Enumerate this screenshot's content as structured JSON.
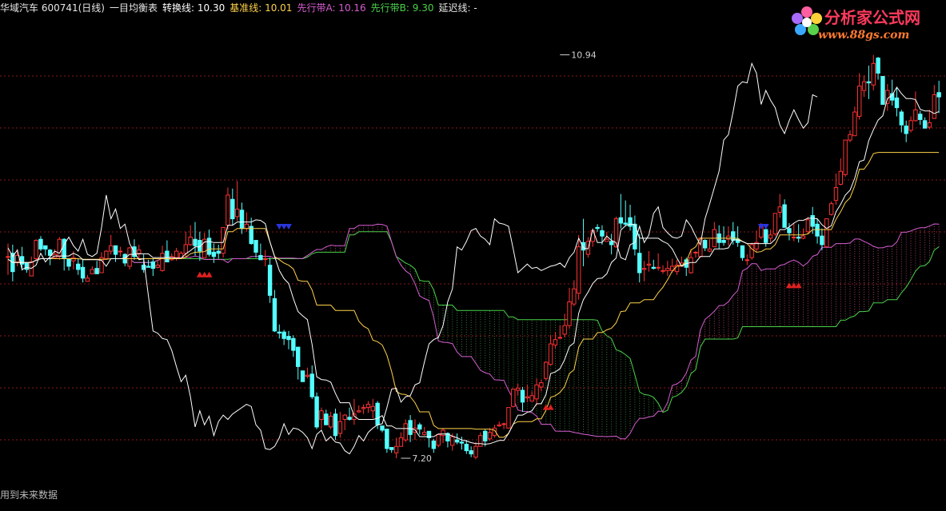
{
  "header": {
    "title": "华域汽车 600741(日线)",
    "indicator": "一目均衡表",
    "zhuanhuan": "转换线: 10.30",
    "jizhun": "基准线: 10.01",
    "xianxingA": "先行带A: 10.16",
    "xianxingB": "先行带B: 9.30",
    "yanchi": "延迟线: -"
  },
  "brand": {
    "name": "分析家公式网",
    "url": "www.88gs.com"
  },
  "footer": {
    "note": "用到未来数据"
  },
  "colors": {
    "background": "#000000",
    "up_candle": "#ff3232",
    "down_candle": "#54ffff",
    "tenkan": "#ffffff",
    "kijun": "#ffd24a",
    "senkou_a": "#d55cd0",
    "senkou_b": "#4ad14a",
    "chikou": "#ffffff",
    "grid": "#8b1a1a"
  },
  "chart_data": {
    "type": "candlestick",
    "ylim": [
      7.0,
      11.3
    ],
    "annotations": [
      {
        "label": "10.94",
        "x": 118,
        "price": 10.94
      },
      {
        "label": "7.20",
        "x": 84,
        "price": 7.2
      }
    ],
    "signal_markers": [
      {
        "shape": "up-triangle",
        "x": [
          41,
          42,
          43
        ],
        "price": 8.9
      },
      {
        "shape": "down-triangle",
        "x": [
          58,
          59,
          60
        ],
        "price": 9.35
      },
      {
        "shape": "up-triangle",
        "x": [
          115,
          116
        ],
        "price": 7.67
      },
      {
        "shape": "down-triangle",
        "x": [
          161,
          162
        ],
        "price": 9.35
      },
      {
        "shape": "up-triangle",
        "x": [
          167,
          168,
          169
        ],
        "price": 8.8
      }
    ],
    "candles": [
      [
        9.07,
        9.19,
        9.07,
        8.9
      ],
      [
        9.1,
        9.18,
        8.93,
        8.84
      ],
      [
        9.02,
        9.14,
        9.08,
        8.98
      ],
      [
        9.07,
        9.16,
        9,
        8.94
      ],
      [
        9.01,
        9.02,
        8.95,
        8.92
      ],
      [
        8.89,
        9.07,
        9.02,
        8.89
      ],
      [
        9.05,
        9.23,
        9.22,
        9.03
      ],
      [
        9.23,
        9.26,
        9.14,
        9.12
      ],
      [
        9.17,
        9.17,
        9.14,
        9.08
      ],
      [
        9.13,
        9.14,
        9.08,
        8.99
      ],
      [
        9.06,
        9.14,
        9.09,
        9.05
      ],
      [
        9.07,
        9.25,
        9.23,
        9.04
      ],
      [
        9.23,
        9.24,
        9.05,
        8.94
      ],
      [
        9.05,
        9.05,
        8.98,
        8.94
      ],
      [
        9.03,
        9.12,
        9.06,
        8.95
      ],
      [
        9,
        9.05,
        8.95,
        8.9
      ],
      [
        8.97,
        9.05,
        8.87,
        8.83
      ],
      [
        8.84,
        8.9,
        8.87,
        8.84
      ],
      [
        8.91,
        8.98,
        8.95,
        8.91
      ],
      [
        8.96,
        9.03,
        8.91,
        8.91
      ],
      [
        8.92,
        9.11,
        9.06,
        8.92
      ],
      [
        9.05,
        9.13,
        9.12,
        9.05
      ],
      [
        9.12,
        9.27,
        9.17,
        9.09
      ],
      [
        9.17,
        9.17,
        9.09,
        9.02
      ],
      [
        9.12,
        9.16,
        9.12,
        9.07
      ],
      [
        9.09,
        9.1,
        9.01,
        8.98
      ],
      [
        8.98,
        9.16,
        9.15,
        8.95
      ],
      [
        9.16,
        9.23,
        9.07,
        9.04
      ],
      [
        9.1,
        9.18,
        9.13,
        9.05
      ],
      [
        8.99,
        9.09,
        8.95,
        8.92
      ],
      [
        8.98,
        9.04,
        8.97,
        8.97
      ],
      [
        9.02,
        9.05,
        8.96,
        8.89
      ],
      [
        8.97,
        9.04,
        8.99,
        8.96
      ],
      [
        8.94,
        9.17,
        9.1,
        8.93
      ],
      [
        9.12,
        9.22,
        9.02,
        9.02
      ],
      [
        9.04,
        9.1,
        9.07,
        9.03
      ],
      [
        9.06,
        9.15,
        9.12,
        9.03
      ],
      [
        9.05,
        9.12,
        9.1,
        9.05
      ],
      [
        9.1,
        9.3,
        9.18,
        9.07
      ],
      [
        9.18,
        9.36,
        9.25,
        9.17
      ],
      [
        9.23,
        9.39,
        9.17,
        9.08
      ],
      [
        9.22,
        9.3,
        9.12,
        9.03
      ],
      [
        9.06,
        9.29,
        9.23,
        9.06
      ],
      [
        9.24,
        9.32,
        9.09,
        9.07
      ],
      [
        9.11,
        9.19,
        9.07,
        9.01
      ],
      [
        9.12,
        9.18,
        9.1,
        9.05
      ],
      [
        9.1,
        9.34,
        9.34,
        9.06
      ],
      [
        9.36,
        9.71,
        9.64,
        9.32
      ],
      [
        9.6,
        9.7,
        9.42,
        9.36
      ],
      [
        9.44,
        9.77,
        9.51,
        9.4
      ],
      [
        9.5,
        9.57,
        9.33,
        9.28
      ],
      [
        9.33,
        9.48,
        9.37,
        9.3
      ],
      [
        9.35,
        9.43,
        9.19,
        9.18
      ],
      [
        9.22,
        9.22,
        9.11,
        9.06
      ],
      [
        9.08,
        9.19,
        9.04,
        9.04
      ],
      [
        9.05,
        9.13,
        9.05,
        8.98
      ],
      [
        8.99,
        9.06,
        8.71,
        8.64
      ],
      [
        8.68,
        8.76,
        8.38,
        8.37
      ],
      [
        8.37,
        8.44,
        8.36,
        8.31
      ],
      [
        8.37,
        8.39,
        8.31,
        8.25
      ],
      [
        8.33,
        8.38,
        8.3,
        8.21
      ],
      [
        8.31,
        8.34,
        8.2,
        8.14
      ],
      [
        8.23,
        8.23,
        8.05,
        7.93
      ],
      [
        8.01,
        8.01,
        7.91,
        7.91
      ],
      [
        7.96,
        8.04,
        7.97,
        7.94
      ],
      [
        7.98,
        8.06,
        7.77,
        7.75
      ],
      [
        7.77,
        7.81,
        7.49,
        7.47
      ],
      [
        7.56,
        7.67,
        7.64,
        7.47
      ],
      [
        7.61,
        7.65,
        7.51,
        7.51
      ],
      [
        7.49,
        7.63,
        7.59,
        7.47
      ],
      [
        7.61,
        7.66,
        7.41,
        7.37
      ],
      [
        7.43,
        7.63,
        7.54,
        7.39
      ],
      [
        7.56,
        7.61,
        7.6,
        7.46
      ],
      [
        7.58,
        7.67,
        7.56,
        7.55
      ],
      [
        7.56,
        7.75,
        7.61,
        7.51
      ],
      [
        7.63,
        7.69,
        7.64,
        7.62
      ],
      [
        7.66,
        7.7,
        7.67,
        7.61
      ],
      [
        7.67,
        7.73,
        7.7,
        7.62
      ],
      [
        7.64,
        7.75,
        7.68,
        7.57
      ],
      [
        7.71,
        7.73,
        7.51,
        7.47
      ],
      [
        7.5,
        7.5,
        7.46,
        7.44
      ],
      [
        7.47,
        7.47,
        7.29,
        7.25
      ],
      [
        7.3,
        7.3,
        7.28,
        7.25
      ],
      [
        7.25,
        7.39,
        7.31,
        7.2
      ],
      [
        7.31,
        7.44,
        7.39,
        7.31
      ],
      [
        7.37,
        7.56,
        7.52,
        7.35
      ],
      [
        7.55,
        7.6,
        7.42,
        7.35
      ],
      [
        7.44,
        7.56,
        7.48,
        7.37
      ],
      [
        7.51,
        7.53,
        7.47,
        7.42
      ],
      [
        7.42,
        7.49,
        7.44,
        7.41
      ],
      [
        7.45,
        7.45,
        7.39,
        7.3
      ],
      [
        7.36,
        7.38,
        7.29,
        7.25
      ],
      [
        7.32,
        7.43,
        7.42,
        7.3
      ],
      [
        7.41,
        7.48,
        7.46,
        7.34
      ],
      [
        7.43,
        7.44,
        7.36,
        7.3
      ],
      [
        7.32,
        7.43,
        7.4,
        7.27
      ],
      [
        7.37,
        7.43,
        7.35,
        7.33
      ],
      [
        7.35,
        7.4,
        7.34,
        7.28
      ],
      [
        7.33,
        7.37,
        7.27,
        7.24
      ],
      [
        7.27,
        7.31,
        7.24,
        7.21
      ],
      [
        7.21,
        7.35,
        7.31,
        7.19
      ],
      [
        7.31,
        7.44,
        7.41,
        7.31
      ],
      [
        7.45,
        7.47,
        7.36,
        7.31
      ],
      [
        7.38,
        7.48,
        7.44,
        7.36
      ],
      [
        7.41,
        7.51,
        7.48,
        7.39
      ],
      [
        7.5,
        7.54,
        7.51,
        7.49
      ],
      [
        7.52,
        7.53,
        7.52,
        7.47
      ],
      [
        7.48,
        7.67,
        7.67,
        7.48
      ],
      [
        7.68,
        7.84,
        7.84,
        7.67
      ],
      [
        7.83,
        7.89,
        7.85,
        7.78
      ],
      [
        7.83,
        7.86,
        7.72,
        7.63
      ],
      [
        7.76,
        7.88,
        7.77,
        7.72
      ],
      [
        7.73,
        7.82,
        7.78,
        7.73
      ],
      [
        7.75,
        7.94,
        7.88,
        7.69
      ],
      [
        7.86,
        7.93,
        7.9,
        7.82
      ],
      [
        7.94,
        8.1,
        8.09,
        7.92
      ],
      [
        8.07,
        8.34,
        8.26,
        8.06
      ],
      [
        8.25,
        8.37,
        8.3,
        8.22
      ],
      [
        8.32,
        8.43,
        8.32,
        8.31
      ],
      [
        8.35,
        8.54,
        8.43,
        8.32
      ],
      [
        8.43,
        8.78,
        8.65,
        8.4
      ],
      [
        8.63,
        8.85,
        8.77,
        8.61
      ],
      [
        8.73,
        9.27,
        9.16,
        8.67
      ],
      [
        9.2,
        9.42,
        9.13,
        8.98
      ],
      [
        9.09,
        9.25,
        9.21,
        9.06
      ],
      [
        9.21,
        9.33,
        9.31,
        9.16
      ],
      [
        9.34,
        9.37,
        9.33,
        9.3
      ],
      [
        9.31,
        9.36,
        9.26,
        9.18
      ],
      [
        9.21,
        9.3,
        9.23,
        9.21
      ],
      [
        9.21,
        9.28,
        9.18,
        9.09
      ],
      [
        9.16,
        9.44,
        9.42,
        9.15
      ],
      [
        9.43,
        9.65,
        9.38,
        9.33
      ],
      [
        9.38,
        9.59,
        9.37,
        9.35
      ],
      [
        9.43,
        9.55,
        9.35,
        9.31
      ],
      [
        9.37,
        9.45,
        9.14,
        9.08
      ],
      [
        9.1,
        9.28,
        8.92,
        8.83
      ],
      [
        8.95,
        9.03,
        8.96,
        8.84
      ],
      [
        8.99,
        9.12,
        9,
        8.93
      ],
      [
        8.97,
        9.04,
        8.96,
        8.95
      ],
      [
        8.97,
        9.1,
        8.97,
        8.94
      ],
      [
        8.94,
        8.99,
        8.94,
        8.91
      ],
      [
        8.94,
        9.03,
        8.96,
        8.89
      ],
      [
        8.94,
        9.05,
        8.98,
        8.92
      ],
      [
        8.93,
        9.04,
        8.99,
        8.9
      ],
      [
        8.98,
        9.07,
        9.01,
        8.98
      ],
      [
        9.04,
        9.06,
        8.97,
        8.89
      ],
      [
        8.92,
        9.14,
        9.06,
        8.91
      ],
      [
        9.11,
        9.12,
        9.11,
        9.06
      ],
      [
        9.07,
        9.25,
        9.24,
        9.06
      ],
      [
        9.22,
        9.23,
        9.15,
        9.12
      ],
      [
        9.12,
        9.23,
        9.14,
        9.11
      ],
      [
        9.16,
        9.39,
        9.32,
        9.16
      ],
      [
        9.28,
        9.36,
        9.2,
        9.14
      ],
      [
        9.22,
        9.35,
        9.2,
        9.17
      ],
      [
        9.23,
        9.35,
        9.26,
        9.17
      ],
      [
        9.3,
        9.39,
        9.22,
        9.18
      ],
      [
        9.23,
        9.35,
        9.2,
        9.16
      ],
      [
        9.17,
        9.17,
        9.06,
        9.03
      ],
      [
        9.04,
        9.09,
        9.04,
        8.99
      ],
      [
        9.06,
        9.2,
        9.18,
        9.04
      ],
      [
        9.14,
        9.31,
        9.2,
        9.11
      ],
      [
        9.25,
        9.38,
        9.35,
        9.23
      ],
      [
        9.32,
        9.33,
        9.2,
        9.16
      ],
      [
        9.24,
        9.32,
        9.27,
        9.2
      ],
      [
        9.28,
        9.47,
        9.47,
        9.26
      ],
      [
        9.48,
        9.65,
        9.53,
        9.43
      ],
      [
        9.55,
        9.6,
        9.34,
        9.34
      ],
      [
        9.33,
        9.38,
        9.29,
        9.22
      ],
      [
        9.25,
        9.38,
        9.25,
        9.21
      ],
      [
        9.25,
        9.37,
        9.24,
        9.2
      ],
      [
        9.24,
        9.33,
        9.26,
        9.23
      ],
      [
        9.3,
        9.44,
        9.41,
        9.28
      ],
      [
        9.45,
        9.53,
        9.35,
        9.28
      ],
      [
        9.37,
        9.42,
        9.26,
        9.19
      ],
      [
        9.26,
        9.33,
        9.18,
        9.13
      ],
      [
        9.16,
        9.42,
        9.42,
        9.16
      ],
      [
        9.46,
        9.58,
        9.56,
        9.45
      ],
      [
        9.59,
        9.84,
        9.71,
        9.55
      ],
      [
        9.74,
        9.98,
        9.86,
        9.73
      ],
      [
        9.83,
        10.15,
        10.15,
        9.81
      ],
      [
        10.15,
        10.24,
        10.2,
        10.13
      ],
      [
        10.19,
        10.46,
        10.41,
        10.19
      ],
      [
        10.37,
        10.77,
        10.65,
        10.34
      ],
      [
        10.61,
        10.75,
        10.69,
        10.55
      ],
      [
        10.69,
        10.84,
        10.68,
        10.53
      ],
      [
        10.66,
        10.94,
        10.86,
        10.61
      ],
      [
        10.91,
        10.92,
        10.77,
        10.71
      ],
      [
        10.74,
        10.74,
        10.48,
        10.48
      ],
      [
        10.49,
        10.67,
        10.61,
        10.42
      ],
      [
        10.58,
        10.71,
        10.52,
        10.47
      ],
      [
        10.54,
        10.64,
        10.45,
        10.37
      ],
      [
        10.41,
        10.43,
        10.29,
        10.22
      ],
      [
        10.28,
        10.33,
        10.21,
        10.13
      ],
      [
        10.24,
        10.37,
        10.33,
        10.22
      ],
      [
        10.33,
        10.6,
        10.43,
        10.32
      ],
      [
        10.39,
        10.42,
        10.34,
        10.29
      ],
      [
        10.33,
        10.36,
        10.26,
        10.26
      ],
      [
        10.27,
        10.43,
        10.31,
        10.25
      ],
      [
        10.35,
        10.66,
        10.57,
        10.35
      ],
      [
        10.59,
        10.7,
        10.55,
        10.4
      ]
    ]
  }
}
